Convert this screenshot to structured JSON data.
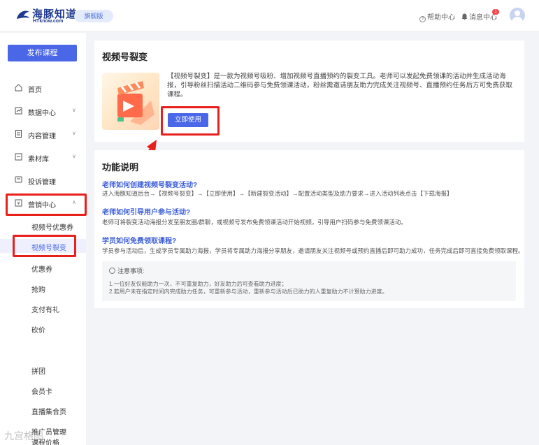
{
  "header": {
    "logo_text": "海豚知道",
    "logo_sub": "HTknow.com",
    "version_label": "旗舰版",
    "help_label": "帮助中心",
    "message_label": "消息中心",
    "message_count": "1"
  },
  "sidebar": {
    "publish_label": "发布课程",
    "items": [
      {
        "label": "首页",
        "icon": "home-icon"
      },
      {
        "label": "数据中心",
        "icon": "chart-icon"
      },
      {
        "label": "内容管理",
        "icon": "document-icon"
      },
      {
        "label": "素材库",
        "icon": "folder-icon"
      },
      {
        "label": "投诉管理",
        "icon": "complaint-icon"
      },
      {
        "label": "营销中心",
        "icon": "marketing-icon"
      }
    ],
    "sub_items": [
      {
        "label": "视频号优惠券"
      },
      {
        "label": "视频号裂变"
      },
      {
        "label": "优惠券"
      },
      {
        "label": "抢购"
      },
      {
        "label": "支付有礼"
      },
      {
        "label": "砍价"
      },
      {
        "label": "拼团"
      },
      {
        "label": "会员卡"
      },
      {
        "label": "直播集合页"
      },
      {
        "label": "推广员管理"
      },
      {
        "label": "课程价格"
      }
    ]
  },
  "feature": {
    "title": "视频号裂变",
    "description": "【视频号裂变】是一款为视频号吸粉、增加视频号直播预约的裂变工具。老师可以发起免费领课的活动并生成活动海报，引导粉丝扫描活动二维码参与免费领课活动，粉丝需邀请朋友助力完成关注视频号、直播预约任务后方可免费获取课程。",
    "use_button": "立即使用"
  },
  "explain": {
    "title": "功能说明",
    "qa": [
      {
        "q": "老师如何创建视频号裂变活动?",
        "a": "进入海豚知道后台→【视频号裂变】→【立即使用】→【新建裂变活动】→配置活动类型及助力要求→进入活动列表点击【下载海报】"
      },
      {
        "q": "老师如何引导用户参与活动?",
        "a": "老师可将裂变活动海报分发至朋友圈/群聊，或视频号发布免费领课活动开始视频，引导用户扫码参与免费领课活动。"
      },
      {
        "q": "学员如何免费领取课程?",
        "a": "学员参与活动后，生成学员专属助力海报，学员将专属助力海报分享朋友，邀请朋友关注视频号或预约直播后即可助力成功，任务完成后即可直接免费领取课程。"
      }
    ],
    "note_title": "注意事项:",
    "notes": [
      "1.一位好友仅能助力一次，不可重复助力，好友助力后可查看助力进度；",
      "2.若用户未在指定时间内完成助力任务，可重新参与活动，重新参与活动后已助力的人重复助力不计算助力进度。"
    ]
  },
  "watermark": "九宫格图",
  "colors": {
    "accent": "#4a67e8",
    "highlight": "#e8201c",
    "link": "#3d5fd8"
  }
}
